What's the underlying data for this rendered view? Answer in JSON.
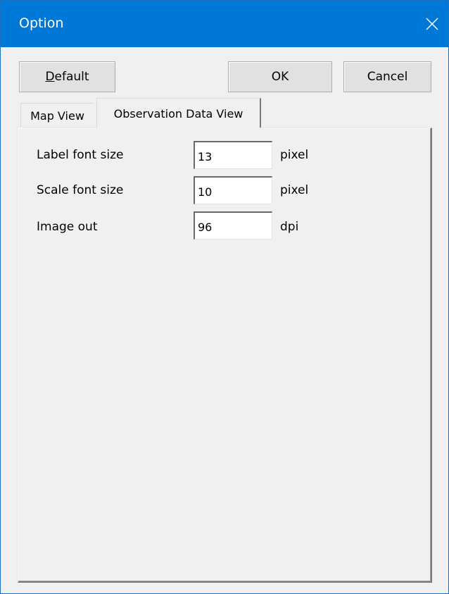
{
  "window": {
    "title": "Option",
    "close_icon": "close-icon",
    "accent_color": "#0078d7"
  },
  "buttons": {
    "default_label_mnemonic": "D",
    "default_label_rest": "efault",
    "ok_label": "OK",
    "cancel_label": "Cancel"
  },
  "tabs": [
    {
      "label": "Map View",
      "selected": false
    },
    {
      "label": "Observation Data View",
      "selected": true
    }
  ],
  "settings": [
    {
      "label": "Label font size",
      "value": "13",
      "unit": "pixel"
    },
    {
      "label": "Scale font size",
      "value": "10",
      "unit": "pixel"
    },
    {
      "label": "Image out",
      "value": "96",
      "unit": "dpi"
    }
  ]
}
